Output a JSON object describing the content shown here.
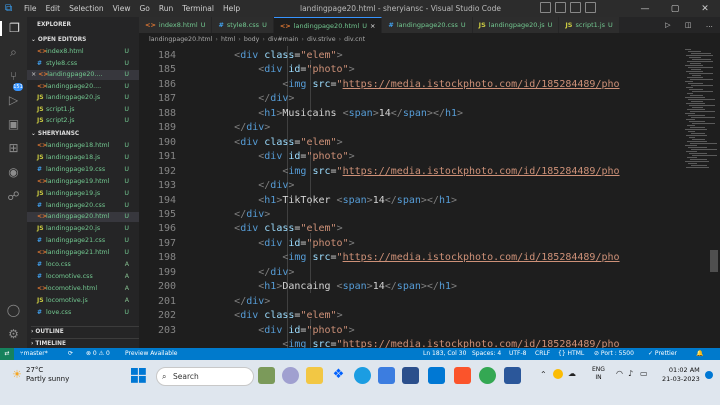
{
  "titlebar": {
    "menu": [
      "File",
      "Edit",
      "Selection",
      "View",
      "Go",
      "Run",
      "Terminal",
      "Help"
    ],
    "title": "landingpage20.html - sheryiansc - Visual Studio Code"
  },
  "sidebar": {
    "explorer_label": "EXPLORER",
    "open_editors_label": "OPEN EDITORS",
    "open_editors": [
      {
        "icon": "<>",
        "icon_color": "#e37933",
        "name": "index8.html",
        "status": "U"
      },
      {
        "icon": "#",
        "icon_color": "#42a5f5",
        "name": "style8.css",
        "status": "U"
      },
      {
        "icon": "<>",
        "icon_color": "#e37933",
        "name": "landingpage20....",
        "status": "U",
        "close": "×"
      },
      {
        "icon": "<>",
        "icon_color": "#e37933",
        "name": "landingpage20....",
        "status": "U"
      },
      {
        "icon": "JS",
        "icon_color": "#cbcb41",
        "name": "landingpage20.js",
        "status": "U"
      },
      {
        "icon": "JS",
        "icon_color": "#cbcb41",
        "name": "script1.js",
        "status": "U"
      },
      {
        "icon": "JS",
        "icon_color": "#cbcb41",
        "name": "script2.js",
        "status": "U"
      }
    ],
    "project_label": "SHERYIANSC",
    "files": [
      {
        "icon": "<>",
        "icon_color": "#e37933",
        "name": "landingpage18.html",
        "status": "U"
      },
      {
        "icon": "JS",
        "icon_color": "#cbcb41",
        "name": "landingpage18.js",
        "status": "U"
      },
      {
        "icon": "#",
        "icon_color": "#42a5f5",
        "name": "landingpage19.css",
        "status": "U"
      },
      {
        "icon": "<>",
        "icon_color": "#e37933",
        "name": "landingpage19.html",
        "status": "U"
      },
      {
        "icon": "JS",
        "icon_color": "#cbcb41",
        "name": "landingpage19.js",
        "status": "U"
      },
      {
        "icon": "#",
        "icon_color": "#42a5f5",
        "name": "landingpage20.css",
        "status": "U"
      },
      {
        "icon": "<>",
        "icon_color": "#e37933",
        "name": "landingpage20.html",
        "status": "U"
      },
      {
        "icon": "JS",
        "icon_color": "#cbcb41",
        "name": "landingpage20.js",
        "status": "U"
      },
      {
        "icon": "#",
        "icon_color": "#42a5f5",
        "name": "landingpage21.css",
        "status": "U"
      },
      {
        "icon": "<>",
        "icon_color": "#e37933",
        "name": "landingpage21.html",
        "status": "U"
      },
      {
        "icon": "#",
        "icon_color": "#42a5f5",
        "name": "loco.css",
        "status": "A"
      },
      {
        "icon": "#",
        "icon_color": "#42a5f5",
        "name": "locomotive.css",
        "status": "A"
      },
      {
        "icon": "<>",
        "icon_color": "#e37933",
        "name": "locomotive.html",
        "status": "A"
      },
      {
        "icon": "JS",
        "icon_color": "#cbcb41",
        "name": "locomotive.js",
        "status": "A"
      },
      {
        "icon": "#",
        "icon_color": "#42a5f5",
        "name": "love.css",
        "status": "U"
      }
    ],
    "outline_label": "OUTLINE",
    "timeline_label": "TIMELINE"
  },
  "tabs": [
    {
      "icon": "<>",
      "icon_color": "#e37933",
      "label": "index8.html",
      "status": "U",
      "active": false
    },
    {
      "icon": "#",
      "icon_color": "#42a5f5",
      "label": "style8.css",
      "status": "U",
      "active": false
    },
    {
      "icon": "<>",
      "icon_color": "#e37933",
      "label": "landingpage20.html",
      "status": "U",
      "active": true,
      "close": "×"
    },
    {
      "icon": "#",
      "icon_color": "#42a5f5",
      "label": "landingpage20.css",
      "status": "U",
      "active": false
    },
    {
      "icon": "JS",
      "icon_color": "#cbcb41",
      "label": "landingpage20.js",
      "status": "U",
      "active": false
    },
    {
      "icon": "JS",
      "icon_color": "#cbcb41",
      "label": "script1.js",
      "status": "U",
      "active": false
    }
  ],
  "breadcrumb": [
    "landingpage20.html",
    "html",
    "body",
    "div#main",
    "div.strive",
    "div.cnt"
  ],
  "editor": {
    "lines": [
      {
        "n": "184",
        "indent": "        ",
        "parts": [
          [
            "g",
            "<"
          ],
          [
            "t",
            "div"
          ],
          [
            "w",
            " "
          ],
          [
            "a",
            "class"
          ],
          [
            "w",
            "="
          ],
          [
            "s",
            "\"elem\""
          ],
          [
            "g",
            ">"
          ]
        ]
      },
      {
        "n": "185",
        "indent": "            ",
        "parts": [
          [
            "g",
            "<"
          ],
          [
            "t",
            "div"
          ],
          [
            "w",
            " "
          ],
          [
            "a",
            "id"
          ],
          [
            "w",
            "="
          ],
          [
            "s",
            "\"photo\""
          ],
          [
            "g",
            ">"
          ]
        ]
      },
      {
        "n": "186",
        "indent": "                ",
        "parts": [
          [
            "g",
            "<"
          ],
          [
            "t",
            "img"
          ],
          [
            "w",
            " "
          ],
          [
            "a",
            "src"
          ],
          [
            "w",
            "="
          ],
          [
            "s",
            "\""
          ],
          [
            "url",
            "https://media.istockphoto.com/id/185284489/pho"
          ]
        ]
      },
      {
        "n": "187",
        "indent": "            ",
        "parts": [
          [
            "g",
            "</"
          ],
          [
            "t",
            "div"
          ],
          [
            "g",
            ">"
          ]
        ]
      },
      {
        "n": "188",
        "indent": "            ",
        "parts": [
          [
            "g",
            "<"
          ],
          [
            "t",
            "h1"
          ],
          [
            "g",
            ">"
          ],
          [
            "w",
            "Musicains "
          ],
          [
            "g",
            "<"
          ],
          [
            "t",
            "span"
          ],
          [
            "g",
            ">"
          ],
          [
            "w",
            "14"
          ],
          [
            "g",
            "</"
          ],
          [
            "t",
            "span"
          ],
          [
            "g",
            "></"
          ],
          [
            "t",
            "h1"
          ],
          [
            "g",
            ">"
          ]
        ]
      },
      {
        "n": "189",
        "indent": "        ",
        "parts": [
          [
            "g",
            "</"
          ],
          [
            "t",
            "div"
          ],
          [
            "g",
            ">"
          ]
        ]
      },
      {
        "n": "190",
        "indent": "        ",
        "parts": [
          [
            "g",
            "<"
          ],
          [
            "t",
            "div"
          ],
          [
            "w",
            " "
          ],
          [
            "a",
            "class"
          ],
          [
            "w",
            "="
          ],
          [
            "s",
            "\"elem\""
          ],
          [
            "g",
            ">"
          ]
        ]
      },
      {
        "n": "191",
        "indent": "            ",
        "parts": [
          [
            "g",
            "<"
          ],
          [
            "t",
            "div"
          ],
          [
            "w",
            " "
          ],
          [
            "a",
            "id"
          ],
          [
            "w",
            "="
          ],
          [
            "s",
            "\"photo\""
          ],
          [
            "g",
            ">"
          ]
        ]
      },
      {
        "n": "192",
        "indent": "                ",
        "parts": [
          [
            "g",
            "<"
          ],
          [
            "t",
            "img"
          ],
          [
            "w",
            " "
          ],
          [
            "a",
            "src"
          ],
          [
            "w",
            "="
          ],
          [
            "s",
            "\""
          ],
          [
            "url",
            "https://media.istockphoto.com/id/185284489/pho"
          ]
        ]
      },
      {
        "n": "193",
        "indent": "            ",
        "parts": [
          [
            "g",
            "</"
          ],
          [
            "t",
            "div"
          ],
          [
            "g",
            ">"
          ]
        ]
      },
      {
        "n": "194",
        "indent": "            ",
        "parts": [
          [
            "g",
            "<"
          ],
          [
            "t",
            "h1"
          ],
          [
            "g",
            ">"
          ],
          [
            "w",
            "TikToker "
          ],
          [
            "g",
            "<"
          ],
          [
            "t",
            "span"
          ],
          [
            "g",
            ">"
          ],
          [
            "w",
            "14"
          ],
          [
            "g",
            "</"
          ],
          [
            "t",
            "span"
          ],
          [
            "g",
            "></"
          ],
          [
            "t",
            "h1"
          ],
          [
            "g",
            ">"
          ]
        ]
      },
      {
        "n": "195",
        "indent": "        ",
        "parts": [
          [
            "g",
            "</"
          ],
          [
            "t",
            "div"
          ],
          [
            "g",
            ">"
          ]
        ]
      },
      {
        "n": "196",
        "indent": "        ",
        "parts": [
          [
            "g",
            "<"
          ],
          [
            "t",
            "div"
          ],
          [
            "w",
            " "
          ],
          [
            "a",
            "class"
          ],
          [
            "w",
            "="
          ],
          [
            "s",
            "\"elem\""
          ],
          [
            "g",
            ">"
          ]
        ]
      },
      {
        "n": "197",
        "indent": "            ",
        "parts": [
          [
            "g",
            "<"
          ],
          [
            "t",
            "div"
          ],
          [
            "w",
            " "
          ],
          [
            "a",
            "id"
          ],
          [
            "w",
            "="
          ],
          [
            "s",
            "\"photo\""
          ],
          [
            "g",
            ">"
          ]
        ]
      },
      {
        "n": "198",
        "indent": "                ",
        "parts": [
          [
            "g",
            "<"
          ],
          [
            "t",
            "img"
          ],
          [
            "w",
            " "
          ],
          [
            "a",
            "src"
          ],
          [
            "w",
            "="
          ],
          [
            "s",
            "\""
          ],
          [
            "url",
            "https://media.istockphoto.com/id/185284489/pho"
          ]
        ]
      },
      {
        "n": "199",
        "indent": "            ",
        "parts": [
          [
            "g",
            "</"
          ],
          [
            "t",
            "div"
          ],
          [
            "g",
            ">"
          ]
        ]
      },
      {
        "n": "200",
        "indent": "            ",
        "parts": [
          [
            "g",
            "<"
          ],
          [
            "t",
            "h1"
          ],
          [
            "g",
            ">"
          ],
          [
            "w",
            "Dancaing "
          ],
          [
            "g",
            "<"
          ],
          [
            "t",
            "span"
          ],
          [
            "g",
            ">"
          ],
          [
            "w",
            "14"
          ],
          [
            "g",
            "</"
          ],
          [
            "t",
            "span"
          ],
          [
            "g",
            "></"
          ],
          [
            "t",
            "h1"
          ],
          [
            "g",
            ">"
          ]
        ]
      },
      {
        "n": "201",
        "indent": "        ",
        "parts": [
          [
            "g",
            "</"
          ],
          [
            "t",
            "div"
          ],
          [
            "g",
            ">"
          ]
        ]
      },
      {
        "n": "202",
        "indent": "        ",
        "parts": [
          [
            "g",
            "<"
          ],
          [
            "t",
            "div"
          ],
          [
            "w",
            " "
          ],
          [
            "a",
            "class"
          ],
          [
            "w",
            "="
          ],
          [
            "s",
            "\"elem\""
          ],
          [
            "g",
            ">"
          ]
        ]
      },
      {
        "n": "203",
        "indent": "            ",
        "parts": [
          [
            "g",
            "<"
          ],
          [
            "t",
            "div"
          ],
          [
            "w",
            " "
          ],
          [
            "a",
            "id"
          ],
          [
            "w",
            "="
          ],
          [
            "s",
            "\"photo\""
          ],
          [
            "g",
            ">"
          ]
        ]
      },
      {
        "n": "",
        "indent": "                ",
        "parts": [
          [
            "g",
            "<"
          ],
          [
            "t",
            "img"
          ],
          [
            "w",
            " "
          ],
          [
            "a",
            "src"
          ],
          [
            "w",
            "="
          ],
          [
            "s",
            "\""
          ],
          [
            "url",
            "https://media.istockphoto.com/id/185284489/pho"
          ]
        ]
      }
    ]
  },
  "statusbar": {
    "branch": "master*",
    "sync": "⟳",
    "problems": "⊗ 0 ⚠ 0",
    "preview": "Preview Available",
    "position": "Ln 183, Col 30",
    "spaces": "Spaces: 4",
    "encoding": "UTF-8",
    "eol": "CRLF",
    "language": "{} HTML",
    "port": "⊘ Port : 5500",
    "prettier": "✓ Prettier"
  },
  "taskbar": {
    "temperature": "27°C",
    "weather": "Partly sunny",
    "search_placeholder": "Search",
    "language": "ENG",
    "region": "IN",
    "time": "01:02 AM",
    "date": "21-03-2023",
    "colors": {
      "windows": "#0078d4",
      "accent_statusbar": "#007acc"
    }
  }
}
